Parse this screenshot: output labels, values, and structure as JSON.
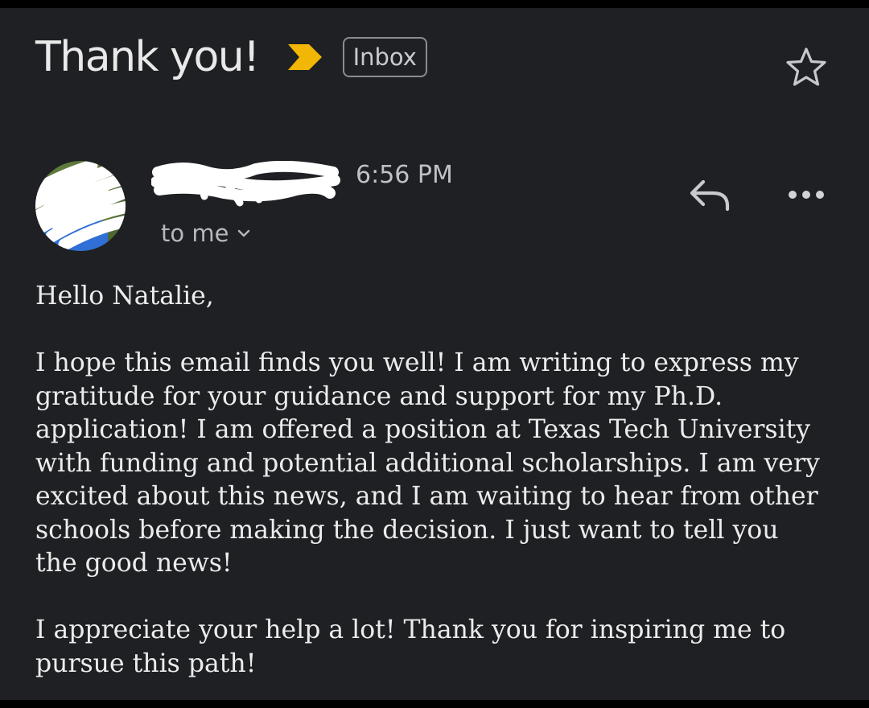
{
  "header": {
    "subject": "Thank you!",
    "label": "Inbox",
    "importance_icon": "importance-marker-icon",
    "importance_color": "#f2b705",
    "star_icon": "star-outline-icon"
  },
  "message": {
    "time": "6:56 PM",
    "recipient": "to me",
    "recipient_icon": "chevron-down-icon",
    "reply_icon": "reply-icon",
    "more_icon": "more-horizontal-icon",
    "sender_redacted": true,
    "avatar_redacted": true,
    "greeting": "Hello Natalie,",
    "paragraph1_lines": [
      "I hope this email finds you well! I am writing to express my",
      "gratitude for your guidance and support for my Ph.D.",
      "application! I am offered a position at Texas Tech University",
      "with funding and potential additional scholarships. I am very",
      "excited about this news, and I am waiting to hear from other",
      "schools before making the decision. I just want to tell you",
      "the good news!"
    ],
    "paragraph2_lines": [
      "I appreciate your help a lot! Thank you for inspiring me to",
      "pursue this path!"
    ]
  },
  "colors": {
    "background": "#1f2023",
    "text": "#ececec",
    "muted_text": "#b7b8bb",
    "importance": "#f2b705"
  }
}
